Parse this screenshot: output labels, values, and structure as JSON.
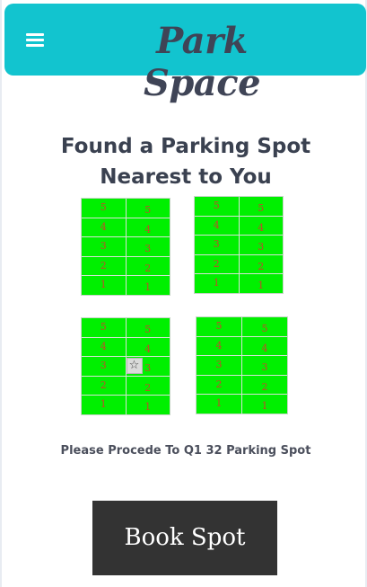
{
  "header": {
    "brand": "Park Space",
    "menu_icon": "hamburger-menu-icon",
    "background": "#12c4cf"
  },
  "main": {
    "heading_line1": "Found a Parking Spot",
    "heading_line2": "Nearest to You",
    "lots": [
      {
        "id": "lot-top-left",
        "rows": [
          [
            "5",
            "5"
          ],
          [
            "4",
            "4"
          ],
          [
            "3",
            "3"
          ],
          [
            "2",
            "2"
          ],
          [
            "1",
            "1"
          ]
        ]
      },
      {
        "id": "lot-top-right",
        "rows": [
          [
            "5",
            "5"
          ],
          [
            "4",
            "4"
          ],
          [
            "3",
            "3"
          ],
          [
            "2",
            "2"
          ],
          [
            "1",
            "1"
          ]
        ]
      },
      {
        "id": "lot-bottom-left",
        "rows": [
          [
            "5",
            "5"
          ],
          [
            "4",
            "4"
          ],
          [
            "3",
            "3"
          ],
          [
            "2",
            "2"
          ],
          [
            "1",
            "1"
          ]
        ],
        "marked_spot": "3-left",
        "marked_icon": "star-icon"
      },
      {
        "id": "lot-bottom-right",
        "rows": [
          [
            "5",
            "5"
          ],
          [
            "4",
            "4"
          ],
          [
            "3",
            "3"
          ],
          [
            "2",
            "2"
          ],
          [
            "1",
            "1"
          ]
        ]
      }
    ],
    "instruction": "Please Procede To  Q1 32 Parking Spot",
    "book_button": "Book Spot",
    "spot_color": "#00f000"
  }
}
